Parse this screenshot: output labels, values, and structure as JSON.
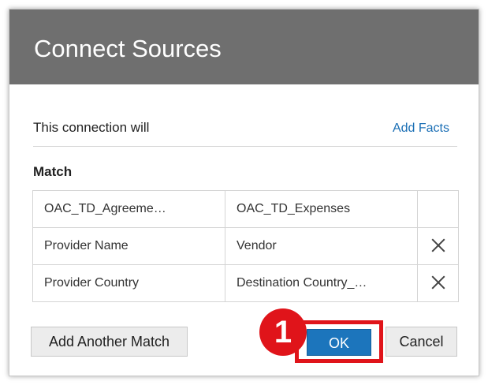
{
  "dialog": {
    "title": "Connect Sources",
    "subtitle": "This connection will",
    "add_facts_link": "Add Facts",
    "match_label": "Match"
  },
  "table": {
    "headers": [
      "OAC_TD_Agreeme…",
      "OAC_TD_Expenses"
    ],
    "rows": [
      {
        "left": "Provider Name",
        "right": "Vendor"
      },
      {
        "left": "Provider Country",
        "right": "Destination Country_…"
      }
    ]
  },
  "buttons": {
    "add_match": "Add Another Match",
    "ok": "OK",
    "cancel": "Cancel"
  },
  "annotation": {
    "step_number": "1"
  },
  "colors": {
    "header_bg": "#6f6f6f",
    "link": "#1b6fb5",
    "primary": "#1c75bc",
    "highlight": "#e0141a"
  },
  "icons": {
    "remove": "close-icon"
  }
}
